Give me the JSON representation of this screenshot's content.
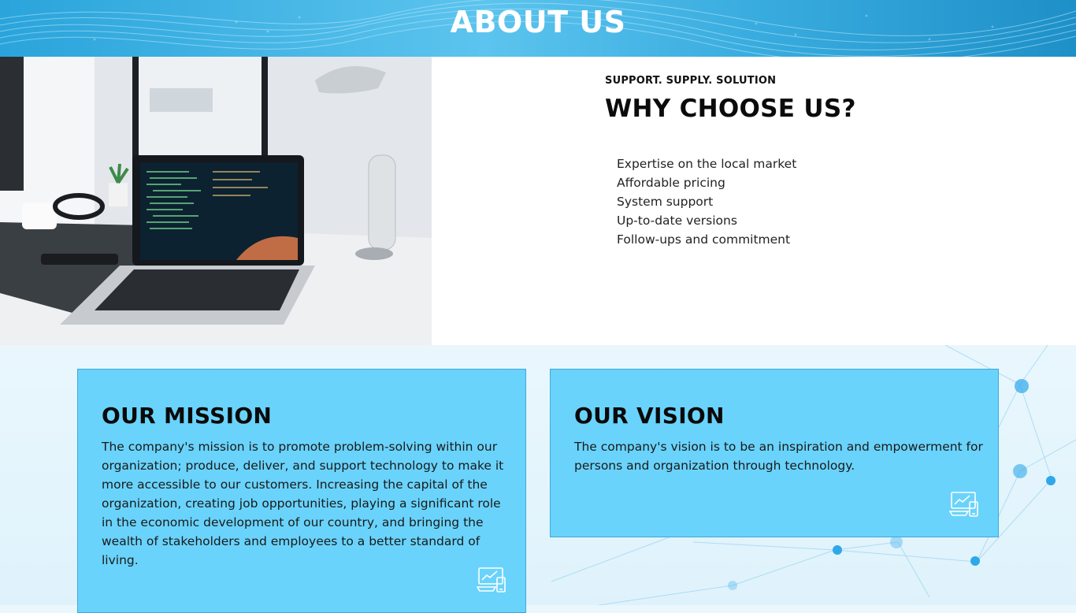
{
  "header": {
    "title": "ABOUT US"
  },
  "why": {
    "kicker": "SUPPORT. SUPPLY. SOLUTION",
    "title": "WHY CHOOSE US?",
    "items": [
      "Expertise on the local market",
      "Affordable pricing",
      "System support",
      "Up-to-date versions",
      "Follow-ups and commitment"
    ]
  },
  "mission": {
    "title": "OUR MISSION",
    "text": "The company's mission is to promote problem-solving within our organization; produce, deliver, and support technology to make it more accessible to our customers. Increasing the capital of the organization, creating job opportunities, playing a significant role in the economic development of our country, and bringing the wealth of stakeholders and employees to a better standard of living.",
    "icon": "devices-icon"
  },
  "vision": {
    "title": "OUR VISION",
    "text": "The company's vision is to be an inspiration and empowerment for persons and organization through technology.",
    "icon": "devices-icon"
  },
  "colors": {
    "header": "#3ab0e2",
    "card": "#6ad3fb",
    "card_border": "#3fa9d8"
  }
}
